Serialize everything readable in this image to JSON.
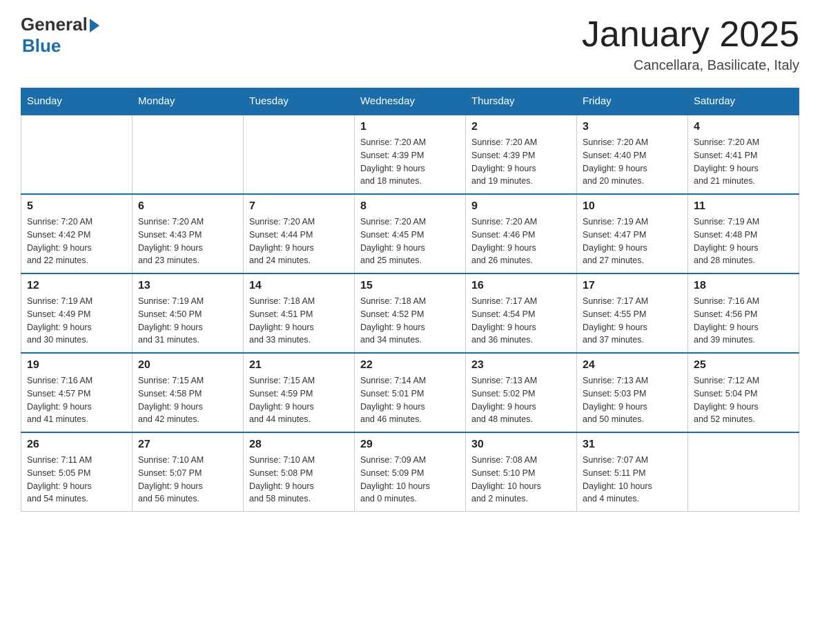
{
  "logo": {
    "general": "General",
    "blue": "Blue"
  },
  "title": "January 2025",
  "location": "Cancellara, Basilicate, Italy",
  "days_header": [
    "Sunday",
    "Monday",
    "Tuesday",
    "Wednesday",
    "Thursday",
    "Friday",
    "Saturday"
  ],
  "weeks": [
    [
      {
        "day": "",
        "info": ""
      },
      {
        "day": "",
        "info": ""
      },
      {
        "day": "",
        "info": ""
      },
      {
        "day": "1",
        "info": "Sunrise: 7:20 AM\nSunset: 4:39 PM\nDaylight: 9 hours\nand 18 minutes."
      },
      {
        "day": "2",
        "info": "Sunrise: 7:20 AM\nSunset: 4:39 PM\nDaylight: 9 hours\nand 19 minutes."
      },
      {
        "day": "3",
        "info": "Sunrise: 7:20 AM\nSunset: 4:40 PM\nDaylight: 9 hours\nand 20 minutes."
      },
      {
        "day": "4",
        "info": "Sunrise: 7:20 AM\nSunset: 4:41 PM\nDaylight: 9 hours\nand 21 minutes."
      }
    ],
    [
      {
        "day": "5",
        "info": "Sunrise: 7:20 AM\nSunset: 4:42 PM\nDaylight: 9 hours\nand 22 minutes."
      },
      {
        "day": "6",
        "info": "Sunrise: 7:20 AM\nSunset: 4:43 PM\nDaylight: 9 hours\nand 23 minutes."
      },
      {
        "day": "7",
        "info": "Sunrise: 7:20 AM\nSunset: 4:44 PM\nDaylight: 9 hours\nand 24 minutes."
      },
      {
        "day": "8",
        "info": "Sunrise: 7:20 AM\nSunset: 4:45 PM\nDaylight: 9 hours\nand 25 minutes."
      },
      {
        "day": "9",
        "info": "Sunrise: 7:20 AM\nSunset: 4:46 PM\nDaylight: 9 hours\nand 26 minutes."
      },
      {
        "day": "10",
        "info": "Sunrise: 7:19 AM\nSunset: 4:47 PM\nDaylight: 9 hours\nand 27 minutes."
      },
      {
        "day": "11",
        "info": "Sunrise: 7:19 AM\nSunset: 4:48 PM\nDaylight: 9 hours\nand 28 minutes."
      }
    ],
    [
      {
        "day": "12",
        "info": "Sunrise: 7:19 AM\nSunset: 4:49 PM\nDaylight: 9 hours\nand 30 minutes."
      },
      {
        "day": "13",
        "info": "Sunrise: 7:19 AM\nSunset: 4:50 PM\nDaylight: 9 hours\nand 31 minutes."
      },
      {
        "day": "14",
        "info": "Sunrise: 7:18 AM\nSunset: 4:51 PM\nDaylight: 9 hours\nand 33 minutes."
      },
      {
        "day": "15",
        "info": "Sunrise: 7:18 AM\nSunset: 4:52 PM\nDaylight: 9 hours\nand 34 minutes."
      },
      {
        "day": "16",
        "info": "Sunrise: 7:17 AM\nSunset: 4:54 PM\nDaylight: 9 hours\nand 36 minutes."
      },
      {
        "day": "17",
        "info": "Sunrise: 7:17 AM\nSunset: 4:55 PM\nDaylight: 9 hours\nand 37 minutes."
      },
      {
        "day": "18",
        "info": "Sunrise: 7:16 AM\nSunset: 4:56 PM\nDaylight: 9 hours\nand 39 minutes."
      }
    ],
    [
      {
        "day": "19",
        "info": "Sunrise: 7:16 AM\nSunset: 4:57 PM\nDaylight: 9 hours\nand 41 minutes."
      },
      {
        "day": "20",
        "info": "Sunrise: 7:15 AM\nSunset: 4:58 PM\nDaylight: 9 hours\nand 42 minutes."
      },
      {
        "day": "21",
        "info": "Sunrise: 7:15 AM\nSunset: 4:59 PM\nDaylight: 9 hours\nand 44 minutes."
      },
      {
        "day": "22",
        "info": "Sunrise: 7:14 AM\nSunset: 5:01 PM\nDaylight: 9 hours\nand 46 minutes."
      },
      {
        "day": "23",
        "info": "Sunrise: 7:13 AM\nSunset: 5:02 PM\nDaylight: 9 hours\nand 48 minutes."
      },
      {
        "day": "24",
        "info": "Sunrise: 7:13 AM\nSunset: 5:03 PM\nDaylight: 9 hours\nand 50 minutes."
      },
      {
        "day": "25",
        "info": "Sunrise: 7:12 AM\nSunset: 5:04 PM\nDaylight: 9 hours\nand 52 minutes."
      }
    ],
    [
      {
        "day": "26",
        "info": "Sunrise: 7:11 AM\nSunset: 5:05 PM\nDaylight: 9 hours\nand 54 minutes."
      },
      {
        "day": "27",
        "info": "Sunrise: 7:10 AM\nSunset: 5:07 PM\nDaylight: 9 hours\nand 56 minutes."
      },
      {
        "day": "28",
        "info": "Sunrise: 7:10 AM\nSunset: 5:08 PM\nDaylight: 9 hours\nand 58 minutes."
      },
      {
        "day": "29",
        "info": "Sunrise: 7:09 AM\nSunset: 5:09 PM\nDaylight: 10 hours\nand 0 minutes."
      },
      {
        "day": "30",
        "info": "Sunrise: 7:08 AM\nSunset: 5:10 PM\nDaylight: 10 hours\nand 2 minutes."
      },
      {
        "day": "31",
        "info": "Sunrise: 7:07 AM\nSunset: 5:11 PM\nDaylight: 10 hours\nand 4 minutes."
      },
      {
        "day": "",
        "info": ""
      }
    ]
  ]
}
